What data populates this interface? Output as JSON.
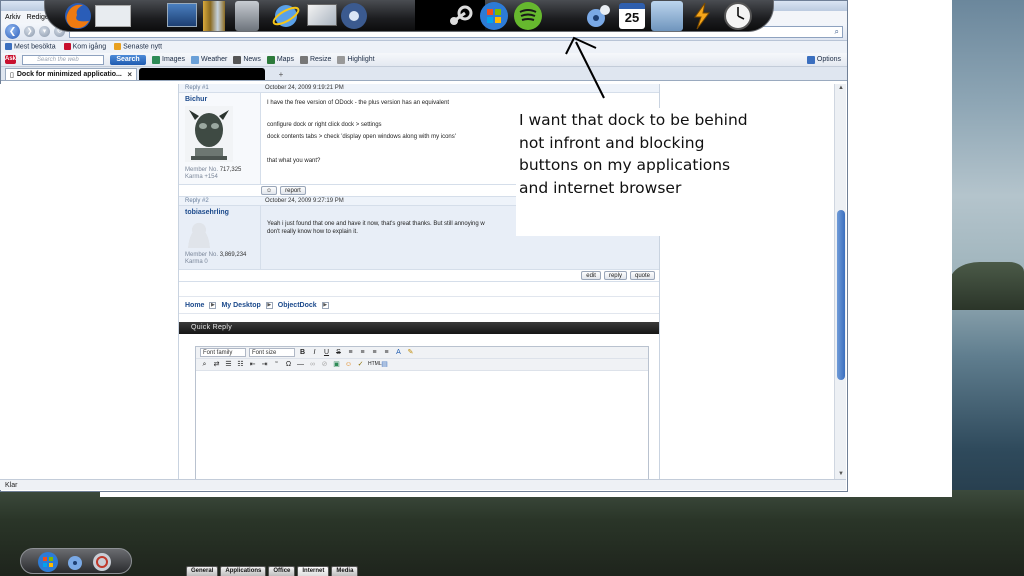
{
  "browser": {
    "menu": [
      "Arkiv",
      "Redigera"
    ],
    "bookmarks": [
      {
        "label": "Mest besökta",
        "color": "#3b6fbf"
      },
      {
        "label": "Kom igång",
        "color": "#c8102e"
      },
      {
        "label": "Senaste nytt",
        "color": "#e8a020"
      }
    ],
    "toolbar": {
      "ask_logo": "Ask",
      "search_placeholder": "Search the web",
      "search_button": "Search",
      "items": [
        {
          "label": "Images",
          "color": "#2e8b57"
        },
        {
          "label": "Weather",
          "color": "#6aa0d8"
        },
        {
          "label": "News",
          "color": "#555555"
        },
        {
          "label": "Maps",
          "color": "#2c7a3a"
        },
        {
          "label": "Resize",
          "color": "#777777"
        },
        {
          "label": "Highlight",
          "color": "#999999"
        }
      ],
      "options": "Options"
    },
    "tabs": [
      {
        "title": "Dock for minimized applicatio...",
        "close": "×"
      }
    ],
    "status": "Klar"
  },
  "forum": {
    "posts": [
      {
        "reply_label": "Reply #1",
        "date": "October 24, 2009 9:19:21 PM",
        "author": "Bichur",
        "member_label": "Member No.",
        "member_no": "717,325",
        "karma_label": "Karma",
        "karma": "+154",
        "lines": [
          "I have the free version of ODock - the plus version has an equivalent",
          "configure dock or right click dock > settings",
          "dock contents tabs > check 'display open windows along with my icons'",
          "that what you want?"
        ],
        "buttons": [
          "report"
        ]
      },
      {
        "reply_label": "Reply #2",
        "date": "October 24, 2009 9:27:19 PM",
        "author": "tobiasehrling",
        "member_label": "Member No.",
        "member_no": "3,869,234",
        "karma_label": "Karma",
        "karma": "0",
        "lines": [
          "Yeah i just found that one and have it now, that's great thanks. But still annoying w",
          "don't really know how to explain it."
        ],
        "buttons": [
          "edit",
          "reply",
          "quote"
        ]
      }
    ],
    "breadcrumb": [
      "Home",
      "My Desktop",
      "ObjectDock"
    ],
    "quick_reply": "Quick Reply",
    "editor": {
      "font_family": "Font family",
      "font_size": "Font size"
    }
  },
  "annotation": {
    "text": "I want that dock to be behind not infront and blocking buttons on my applications and internet browser"
  },
  "dock": {
    "bottom_tabs": [
      "General",
      "Applications",
      "Office",
      "Internet",
      "Media"
    ],
    "calendar_day": "25"
  }
}
